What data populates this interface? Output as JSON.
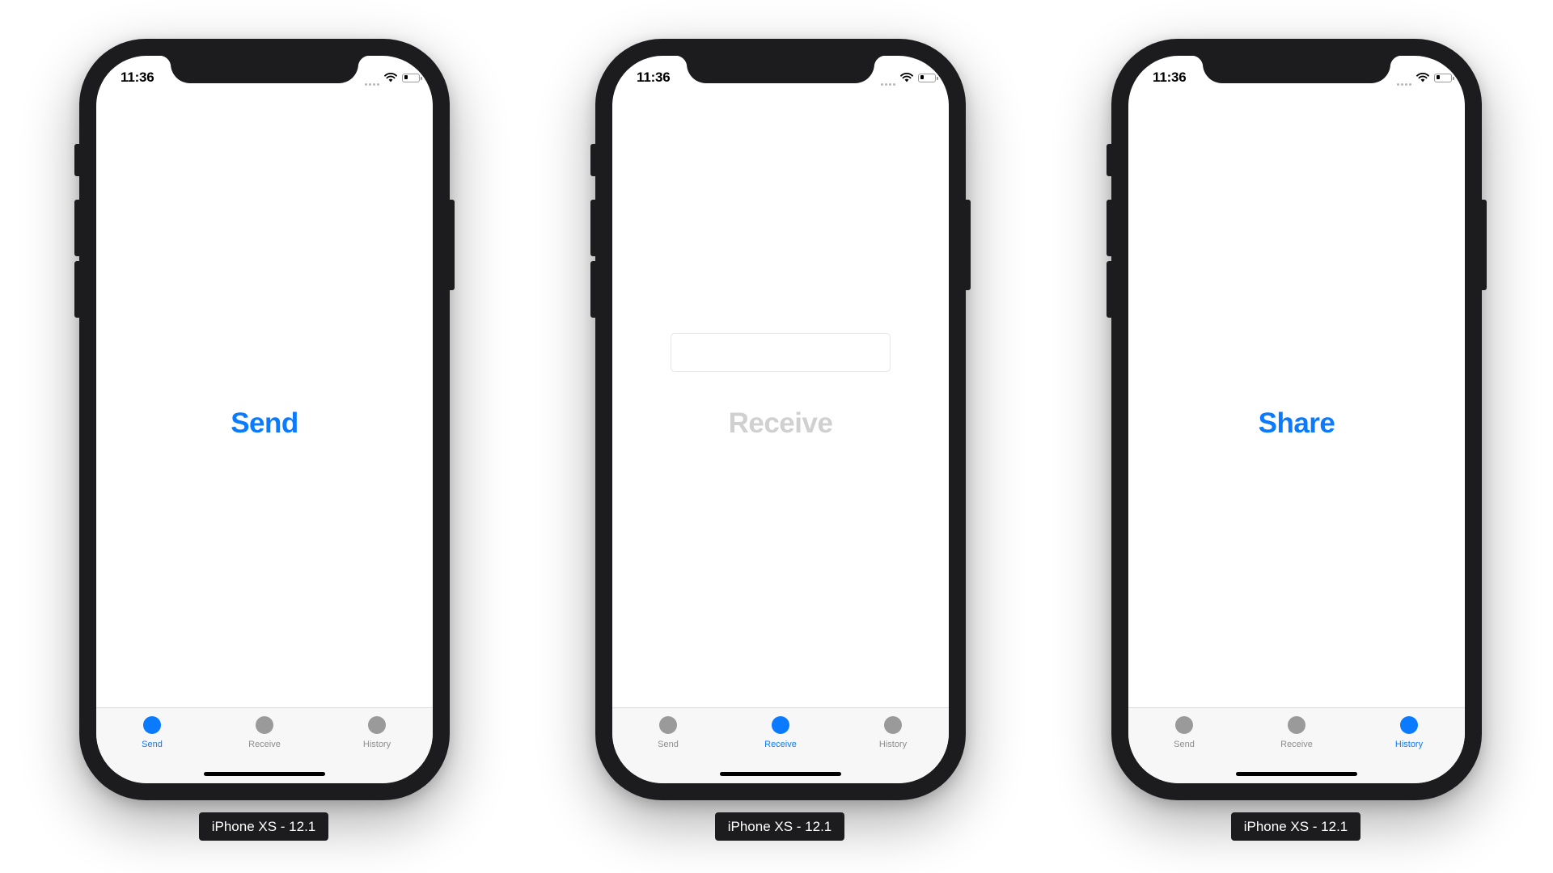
{
  "devices": [
    {
      "status_time": "11:36",
      "center_label": "Send",
      "center_label_enabled": true,
      "show_text_field": false,
      "tabs": [
        "Send",
        "Receive",
        "History"
      ],
      "active_tab": 0,
      "device_label": "iPhone XS - 12.1"
    },
    {
      "status_time": "11:36",
      "center_label": "Receive",
      "center_label_enabled": false,
      "show_text_field": true,
      "tabs": [
        "Send",
        "Receive",
        "History"
      ],
      "active_tab": 1,
      "device_label": "iPhone XS - 12.1"
    },
    {
      "status_time": "11:36",
      "center_label": "Share",
      "center_label_enabled": true,
      "show_text_field": false,
      "tabs": [
        "Send",
        "Receive",
        "History"
      ],
      "active_tab": 2,
      "device_label": "iPhone XS - 12.1"
    }
  ],
  "colors": {
    "accent": "#0a7aff",
    "disabled_text": "#d0d0d0",
    "inactive_tab": "#9a9a9a",
    "bezel": "#1c1c1e"
  },
  "icons": {
    "signal": "cellular-dots-icon",
    "wifi": "wifi-icon",
    "battery": "battery-icon",
    "tab_item": "circle-icon"
  }
}
